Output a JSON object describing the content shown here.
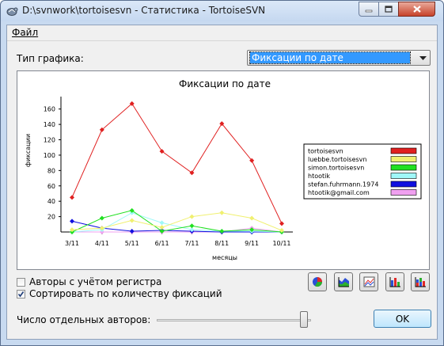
{
  "window": {
    "title": "D:\\svnwork\\tortoisesvn - Статистика - TortoiseSVN"
  },
  "menu": {
    "file": "Файл"
  },
  "graph_type": {
    "label": "Тип графика:",
    "selected": "Фиксации по дате"
  },
  "options": {
    "case_sensitive_label": "Авторы с учётом регистра",
    "case_sensitive_checked": false,
    "sort_label": "Сортировать по количеству фиксаций",
    "sort_checked": true
  },
  "authors_count_label": "Число отдельных авторов:",
  "authors_slider_value": 1.0,
  "ok_label": "OK",
  "toolbar": {
    "buttons": [
      "pie-chart-icon",
      "area-chart-icon",
      "stacked-line-icon",
      "grouped-bar-icon",
      "stacked-bar-icon"
    ]
  },
  "colors": {
    "window_frame": "#c8daf0",
    "close_button": "#c7422a"
  },
  "chart_data": {
    "type": "line",
    "title": "Фиксации по дате",
    "xlabel": "месяцы",
    "ylabel": "фиксации",
    "categories": [
      "3/11",
      "4/11",
      "5/11",
      "6/11",
      "7/11",
      "8/11",
      "9/11",
      "10/11"
    ],
    "yticks": [
      20,
      40,
      60,
      80,
      100,
      120,
      140,
      160
    ],
    "ylim": [
      0,
      170
    ],
    "legend_position": "right",
    "series": [
      {
        "name": "tortoisesvn",
        "color": "#e02020",
        "values": [
          45,
          133,
          167,
          105,
          77,
          141,
          93,
          11
        ]
      },
      {
        "name": "luebbe.tortoisesvn",
        "color": "#f0f070",
        "values": [
          3,
          5,
          15,
          6,
          20,
          25,
          18,
          2
        ]
      },
      {
        "name": "simon.tortoisesvn",
        "color": "#20e020",
        "values": [
          0,
          18,
          28,
          1,
          8,
          1,
          3,
          0
        ]
      },
      {
        "name": "htootik",
        "color": "#a0f8f8",
        "values": [
          0,
          3,
          25,
          12,
          3,
          1,
          1,
          0
        ]
      },
      {
        "name": "stefan.fuhrmann.1974",
        "color": "#1010e0",
        "values": [
          14,
          5,
          1,
          2,
          1,
          0,
          0,
          0
        ]
      },
      {
        "name": "htootik@gmail.com",
        "color": "#f0a0f0",
        "values": [
          0,
          0,
          0,
          0,
          0,
          0,
          5,
          0
        ]
      }
    ]
  }
}
